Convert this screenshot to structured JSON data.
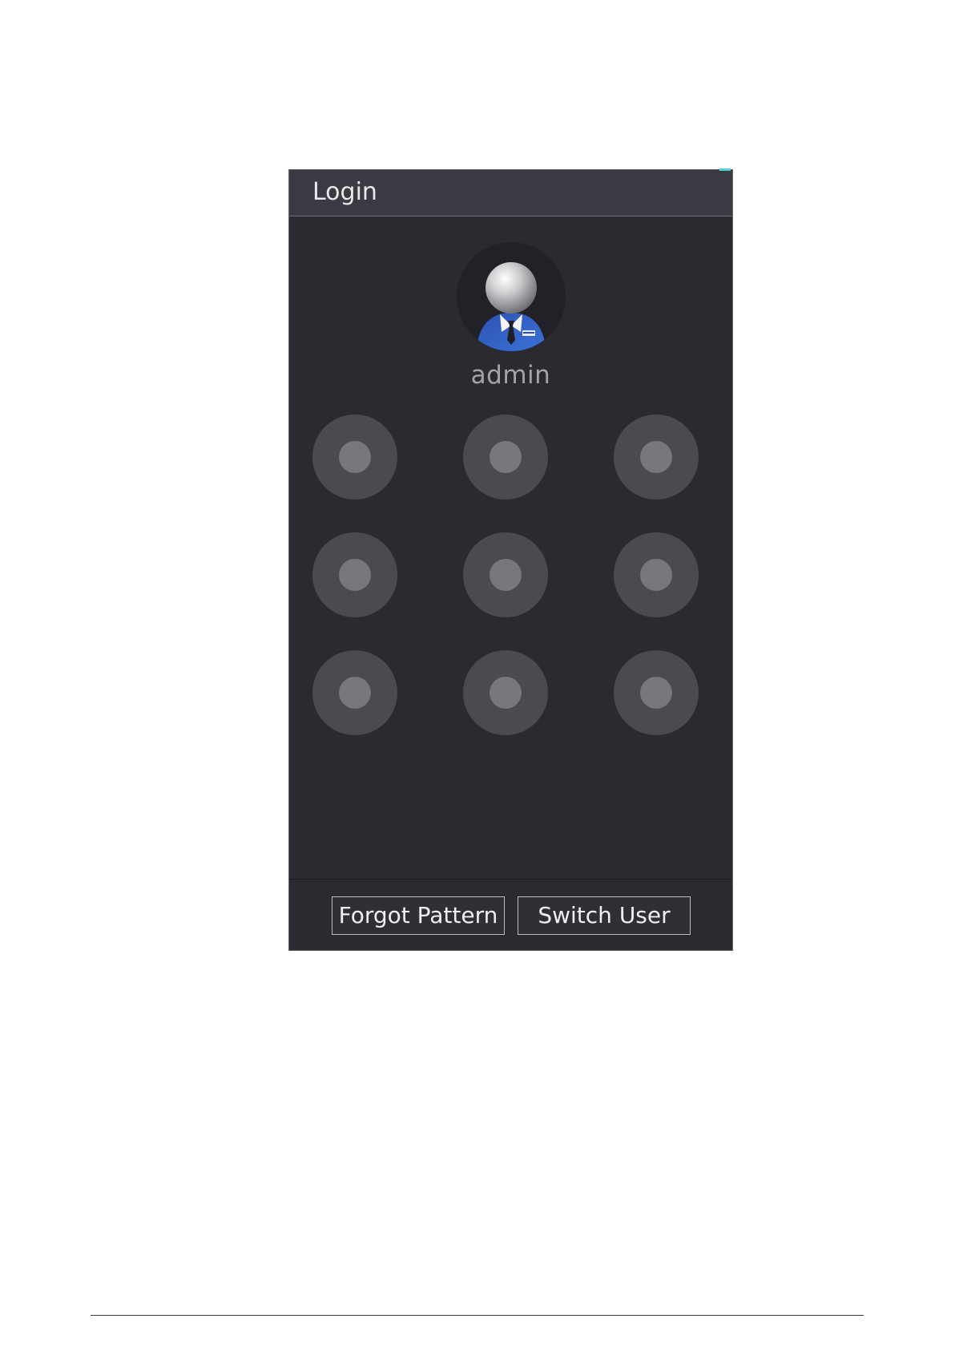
{
  "dialog": {
    "title": "Login",
    "username": "admin",
    "pattern_dots": 9,
    "buttons": {
      "forgot_pattern": "Forgot Pattern",
      "switch_user": "Switch User"
    }
  },
  "colors": {
    "dialog_background": "#2a2a30",
    "header_background": "#3a3a42",
    "dot_outer": "#4a4a50",
    "dot_inner": "#77777e",
    "avatar_suit": "#2f5fc4"
  },
  "icons": {
    "avatar": "user-avatar-icon"
  }
}
